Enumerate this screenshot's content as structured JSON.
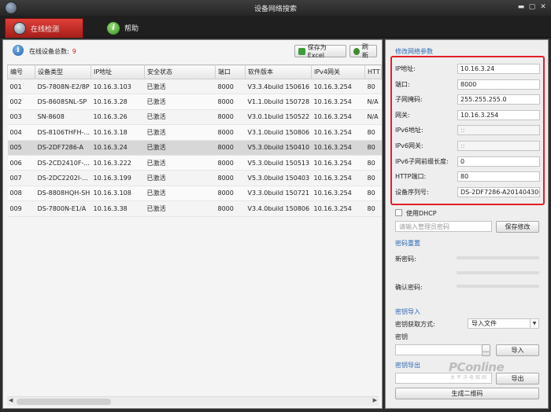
{
  "window": {
    "title": "设备网络搜索"
  },
  "toolbar": {
    "tabs": [
      {
        "label": "在线检测",
        "icon": "scan-icon"
      },
      {
        "label": "帮助",
        "icon": "help-icon"
      }
    ]
  },
  "left": {
    "count_label": "在线设备总数:",
    "count_value": "9",
    "export_label": "保存为Excel",
    "refresh_label": "刷新",
    "columns": [
      "编号",
      "设备类型",
      "IP地址",
      "安全状态",
      "端口",
      "软件版本",
      "IPv4网关",
      "HTT"
    ],
    "rows": [
      [
        "001",
        "DS-7808N-E2/8P",
        "10.16.3.103",
        "已激活",
        "8000",
        "V3.3.4build 150616",
        "10.16.3.254",
        "80"
      ],
      [
        "002",
        "DS-8608SNL-SP",
        "10.16.3.28",
        "已激活",
        "8000",
        "V1.1.0build 150728",
        "10.16.3.254",
        "N/A"
      ],
      [
        "003",
        "SN-8608",
        "10.16.3.26",
        "已激活",
        "8000",
        "V3.0.1build 150522",
        "10.16.3.254",
        "N/A"
      ],
      [
        "004",
        "DS-8106THFH-...",
        "10.16.3.18",
        "已激活",
        "8000",
        "V3.1.0build 150806",
        "10.16.3.254",
        "80"
      ],
      [
        "005",
        "DS-2DF7286-A",
        "10.16.3.24",
        "已激活",
        "8000",
        "V5.3.0build 150410",
        "10.16.3.254",
        "80"
      ],
      [
        "006",
        "DS-2CD2410F-...",
        "10.16.3.222",
        "已激活",
        "8000",
        "V5.3.0build 150513",
        "10.16.3.254",
        "80"
      ],
      [
        "007",
        "DS-2DC2202I-...",
        "10.16.3.199",
        "已激活",
        "8000",
        "V5.3.0build 150403",
        "10.16.3.254",
        "80"
      ],
      [
        "008",
        "DS-8808HQH-SH",
        "10.16.3.108",
        "已激活",
        "8000",
        "V3.3.0build 150721",
        "10.16.3.254",
        "80"
      ],
      [
        "009",
        "DS-7800N-E1/A",
        "10.16.3.38",
        "已激活",
        "8000",
        "V3.4.0build 150806",
        "10.16.3.254",
        "80"
      ]
    ],
    "selected_row": "005"
  },
  "right": {
    "modify_title": "修改网络参数",
    "fields": [
      {
        "label": "IP地址:",
        "value": "10.16.3.24"
      },
      {
        "label": "端口:",
        "value": "8000"
      },
      {
        "label": "子网掩码:",
        "value": "255.255.255.0"
      },
      {
        "label": "网关:",
        "value": "10.16.3.254"
      },
      {
        "label": "IPv6地址:",
        "value": "::"
      },
      {
        "label": "IPv6网关:",
        "value": "::"
      },
      {
        "label": "IPv6子网前缀长度:",
        "value": "0"
      },
      {
        "label": "HTTP端口:",
        "value": "80"
      },
      {
        "label": "设备序列号:",
        "value": "DS-2DF7286-A20140430C"
      }
    ],
    "dhcp_label": "使用DHCP",
    "admin_pw_placeholder": "请输入管理员密码",
    "save_label": "保存修改",
    "reset_title": "密码重置",
    "new_pw_label": "新密码:",
    "confirm_pw_label": "确认密码:",
    "import_title": "密钥导入",
    "import_method_label": "密钥获取方式:",
    "import_method_value": "导入文件",
    "key_label": "密钥",
    "browse_label": "...",
    "import_btn": "导入",
    "export_title": "密钥导出",
    "export_btn": "导出",
    "qr_btn": "生成二维码"
  },
  "watermark": {
    "main": "PConline",
    "sub": "太平洋电脑网"
  },
  "colors": {
    "accent_red": "#e21f26",
    "section_blue": "#2d67b3",
    "count_red": "#d62020"
  }
}
